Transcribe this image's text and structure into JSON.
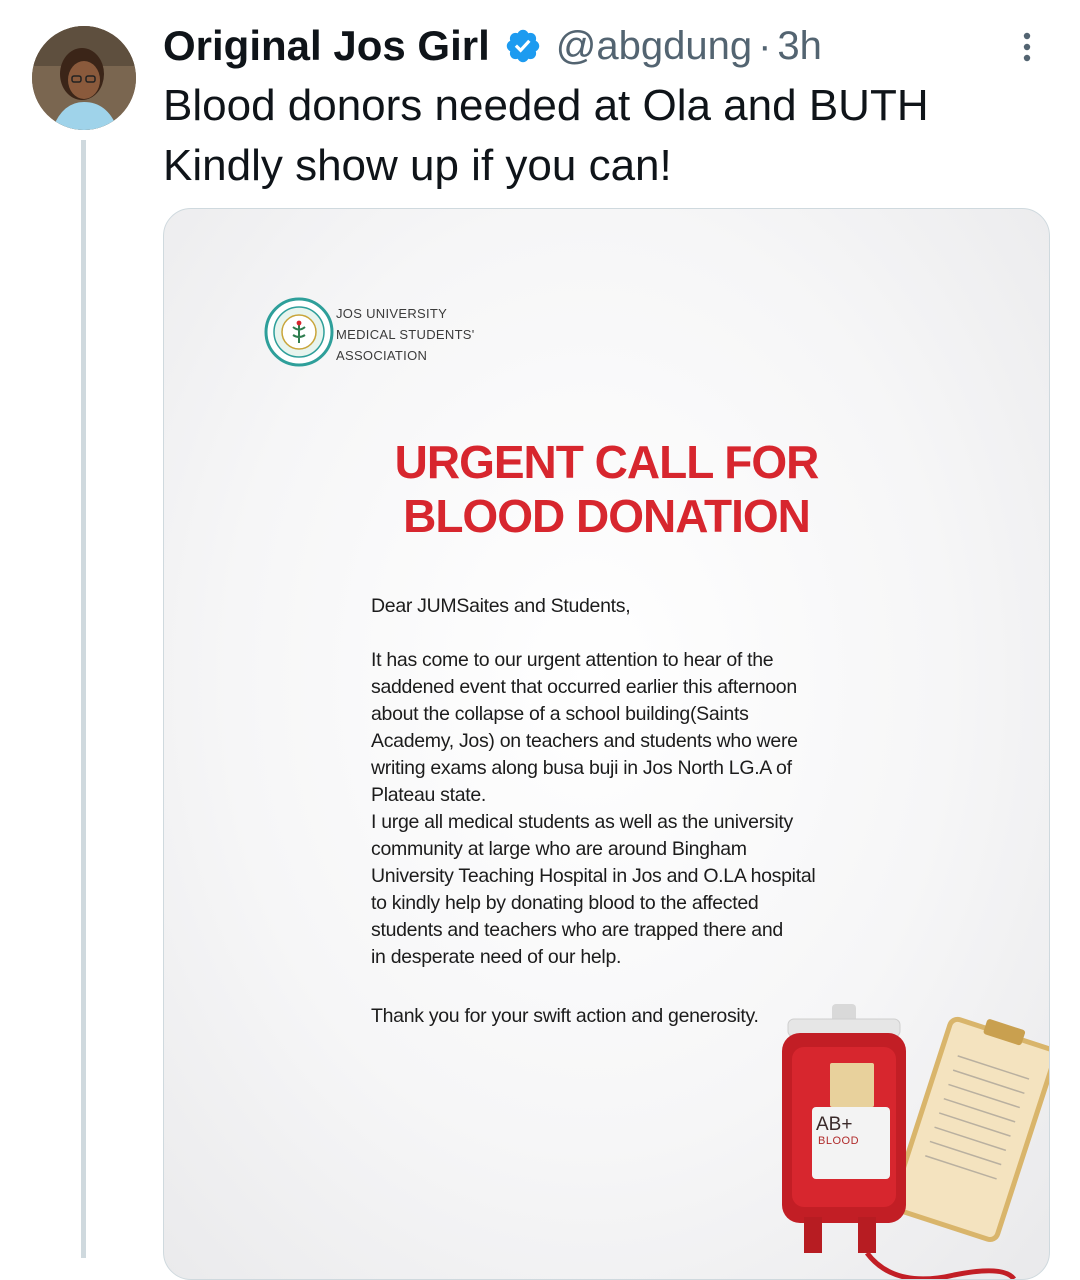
{
  "tweet": {
    "author_name": "Original Jos Girl",
    "handle": "@abgdung",
    "separator": "·",
    "time": "3h",
    "text_lines": [
      "Blood donors needed at Ola and BUTH",
      "Kindly show up if you can!"
    ]
  },
  "media": {
    "org_lines": [
      "JOS UNIVERSITY",
      "MEDICAL STUDENTS'",
      "ASSOCIATION"
    ],
    "headline_lines": [
      "URGENT CALL FOR",
      "BLOOD DONATION"
    ],
    "greeting": "Dear JUMSaites and Students,",
    "body_lines": [
      "It has come to our urgent attention to hear of the",
      "saddened event that occurred earlier this afternoon",
      "about the collapse of a school building(Saints",
      "Academy, Jos) on teachers and students who were",
      "writing exams along busa buji in Jos North LG.A of",
      "Plateau state.",
      "I urge all medical students as well as the university",
      "community at large who are around Bingham",
      "University Teaching Hospital in Jos and O.LA hospital",
      "to kindly help by donating blood to the affected",
      "students and teachers who are trapped there and",
      "in desperate need of our help."
    ],
    "closing": "Thank you for your swift action and generosity.",
    "bag_type": "AB+",
    "bag_label": "BLOOD"
  },
  "colors": {
    "verified": "#1d9bf0",
    "headline": "#d7262e",
    "muted": "#536471"
  },
  "icons": {
    "verified": "verified-badge-icon",
    "more": "more-vertical-icon"
  }
}
